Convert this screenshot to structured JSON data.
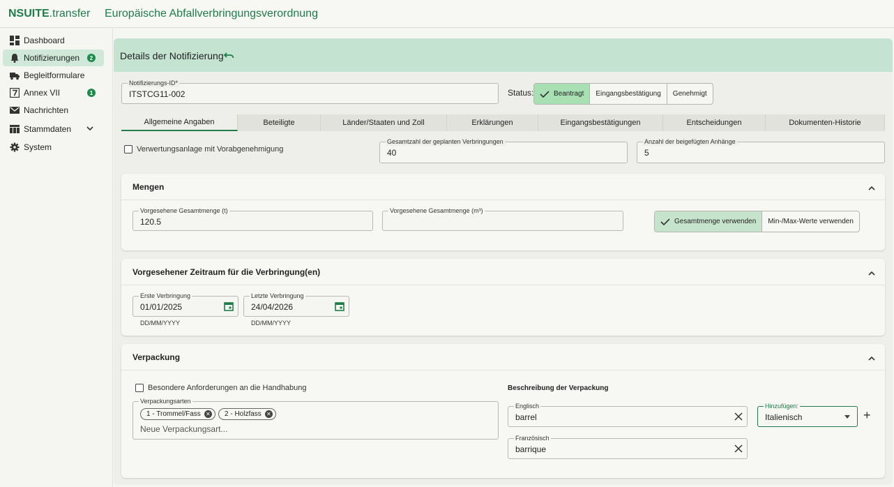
{
  "topbar": {
    "brand_bold": "NSUITE",
    "brand_rest": ".transfer",
    "title": "Europäische Abfallverbringungsverordnung"
  },
  "sidebar": {
    "items": [
      {
        "label": "Dashboard",
        "icon": "dashboard-icon"
      },
      {
        "label": "Notifizierungen",
        "icon": "bell-icon",
        "badge": "2",
        "active": true
      },
      {
        "label": "Begleitformulare",
        "icon": "truck-icon"
      },
      {
        "label": "Annex VII",
        "icon": "annex-icon",
        "badge": "1"
      },
      {
        "label": "Nachrichten",
        "icon": "mail-icon"
      },
      {
        "label": "Stammdaten",
        "icon": "table-icon",
        "expandable": true
      },
      {
        "label": "System",
        "icon": "gear-icon"
      }
    ]
  },
  "detail": {
    "title": "Details der Notifizierung",
    "id_label": "Notifizierungs-ID*",
    "id_value": "ITSTCG11-002",
    "status_label": "Status:",
    "status_options": [
      "Beantragt",
      "Eingangsbestätigung",
      "Genehmigt"
    ],
    "status_selected": "Beantragt"
  },
  "tabs": [
    "Allgemeine Angaben",
    "Beteiligte",
    "Länder/Staaten und Zoll",
    "Erklärungen",
    "Eingangsbestätigungen",
    "Entscheidungen",
    "Dokumenten-Historie"
  ],
  "general": {
    "checkbox_label": "Verwertungsanlage mit Vorabgenehmigung",
    "checkbox_checked": false,
    "planned_label": "Gesamtzahl der geplanten Verbringungen",
    "planned_value": "40",
    "attachments_label": "Anzahl der beigefügten Anhänge",
    "attachments_value": "5"
  },
  "mengen": {
    "title": "Mengen",
    "tonnes_label": "Vorgesehene Gesamtmenge (t)",
    "tonnes_value": "120.5",
    "m3_label": "Vorgesehene Gesamtmenge (m³)",
    "m3_value": "",
    "toggle_on": "Gesamtmenge verwenden",
    "toggle_off": "Min-/Max-Werte verwenden"
  },
  "zeitraum": {
    "title": "Vorgesehener Zeitraum für die Verbringung(en)",
    "first_label": "Erste Verbringung",
    "first_value": "01/01/2025",
    "last_label": "Letzte Verbringung",
    "last_value": "24/04/2026",
    "format_hint": "DD/MM/YYYY"
  },
  "verpackung": {
    "title": "Verpackung",
    "checkbox_label": "Besondere Anforderungen an die Handhabung",
    "checkbox_checked": false,
    "types_label": "Verpackungsarten",
    "chips": [
      "1 - Trommel/Fass",
      "2 - Holzfass"
    ],
    "types_placeholder": "Neue Verpackungsart...",
    "desc_heading": "Beschreibung der Verpackung",
    "english_label": "Englisch",
    "english_value": "barrel",
    "french_label": "Französisch",
    "french_value": "barrique",
    "add_label": "Hinzufügen:",
    "add_value": "Italienisch"
  },
  "colors": {
    "accent": "#1e7d48",
    "header_bg": "#c4e3d1",
    "active_status": "#a8e0b4"
  }
}
